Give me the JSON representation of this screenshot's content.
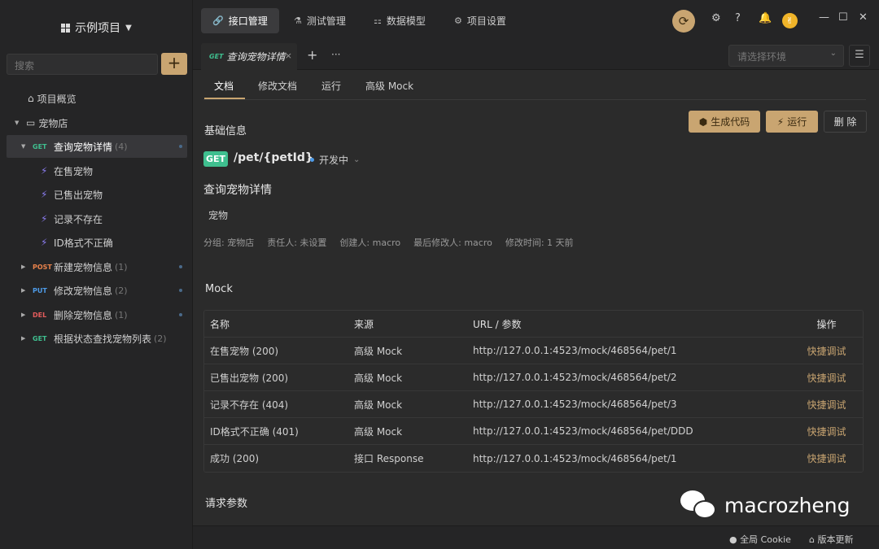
{
  "sidebar": {
    "project_title": "示例项目",
    "search_placeholder": "搜索",
    "add_label": "+",
    "overview": "项目概览",
    "folder": "宠物店",
    "items": [
      {
        "method": "GET",
        "label": "查询宠物详情",
        "count": "(4)"
      },
      {
        "method": "POST",
        "label": "新建宠物信息",
        "count": "(1)"
      },
      {
        "method": "PUT",
        "label": "修改宠物信息",
        "count": "(2)"
      },
      {
        "method": "DEL",
        "label": "删除宠物信息",
        "count": "(1)"
      },
      {
        "method": "GET",
        "label": "根据状态查找宠物列表",
        "count": "(2)"
      }
    ],
    "cases": [
      "在售宠物",
      "已售出宠物",
      "记录不存在",
      "ID格式不正确"
    ]
  },
  "topnav": {
    "tabs": [
      "接口管理",
      "测试管理",
      "数据模型",
      "项目设置"
    ]
  },
  "tabbar": {
    "method": "GET",
    "title": "查询宠物详情",
    "close": "×",
    "add": "+",
    "more": "···",
    "env_placeholder": "请选择环境"
  },
  "subtabs": [
    "文档",
    "修改文档",
    "运行",
    "高级 Mock"
  ],
  "basic": {
    "section_title": "基础信息",
    "gen_code": "生成代码",
    "run": "运行",
    "delete": "删 除",
    "method": "GET",
    "path": "/pet/{petId}",
    "status": "开发中",
    "api_title": "查询宠物详情",
    "tag": "宠物",
    "meta": [
      "分组: 宠物店",
      "责任人: 未设置",
      "创建人: macro",
      "最后修改人: macro",
      "修改时间: 1 天前"
    ]
  },
  "mock": {
    "section_title": "Mock",
    "headers": [
      "名称",
      "来源",
      "URL / 参数",
      "操作"
    ],
    "rows": [
      {
        "name": "在售宠物 (200)",
        "source": "高级 Mock",
        "url": "http://127.0.0.1:4523/mock/468564/pet/1",
        "action": "快捷调试"
      },
      {
        "name": "已售出宠物 (200)",
        "source": "高级 Mock",
        "url": "http://127.0.0.1:4523/mock/468564/pet/2",
        "action": "快捷调试"
      },
      {
        "name": "记录不存在 (404)",
        "source": "高级 Mock",
        "url": "http://127.0.0.1:4523/mock/468564/pet/3",
        "action": "快捷调试"
      },
      {
        "name": "ID格式不正确 (401)",
        "source": "高级 Mock",
        "url": "http://127.0.0.1:4523/mock/468564/pet/DDD",
        "action": "快捷调试"
      },
      {
        "name": "成功 (200)",
        "source": "接口 Response",
        "url": "http://127.0.0.1:4523/mock/468564/pet/1",
        "action": "快捷调试"
      }
    ]
  },
  "params": {
    "section_title": "请求参数"
  },
  "bottom": {
    "cookie": "全局 Cookie",
    "update": "版本更新"
  },
  "watermark": "macrozheng"
}
